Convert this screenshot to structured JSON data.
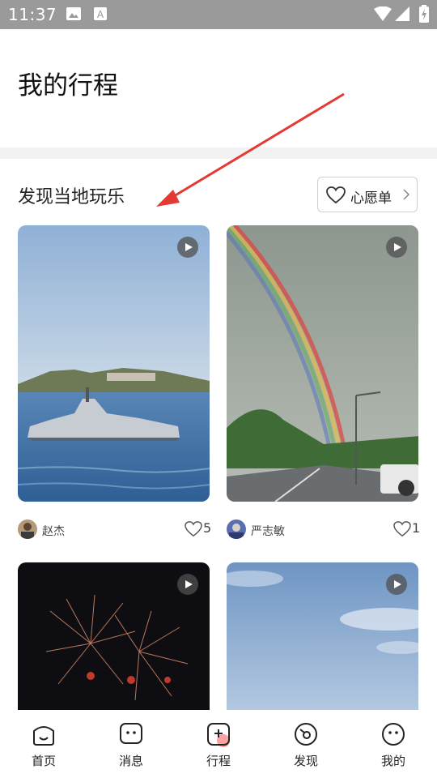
{
  "status_bar": {
    "time": "11:37"
  },
  "page": {
    "title": "我的行程"
  },
  "section": {
    "title": "发现当地玩乐",
    "wishlist_label": "心愿单"
  },
  "cards": [
    {
      "author": "赵杰",
      "likes": "5"
    },
    {
      "author": "严志敏",
      "likes": "1"
    },
    {
      "author": "",
      "likes": ""
    },
    {
      "author": "",
      "likes": ""
    }
  ],
  "tabs": [
    {
      "label": "首页",
      "icon": "home-face-icon"
    },
    {
      "label": "消息",
      "icon": "message-face-icon"
    },
    {
      "label": "行程",
      "icon": "trip-plus-icon"
    },
    {
      "label": "发现",
      "icon": "discover-compass-icon"
    },
    {
      "label": "我的",
      "icon": "profile-face-icon"
    }
  ],
  "colors": {
    "accent_arrow": "#e53935",
    "status_bar": "#9a9a9a",
    "badge_pink": "#ff8a8a"
  }
}
